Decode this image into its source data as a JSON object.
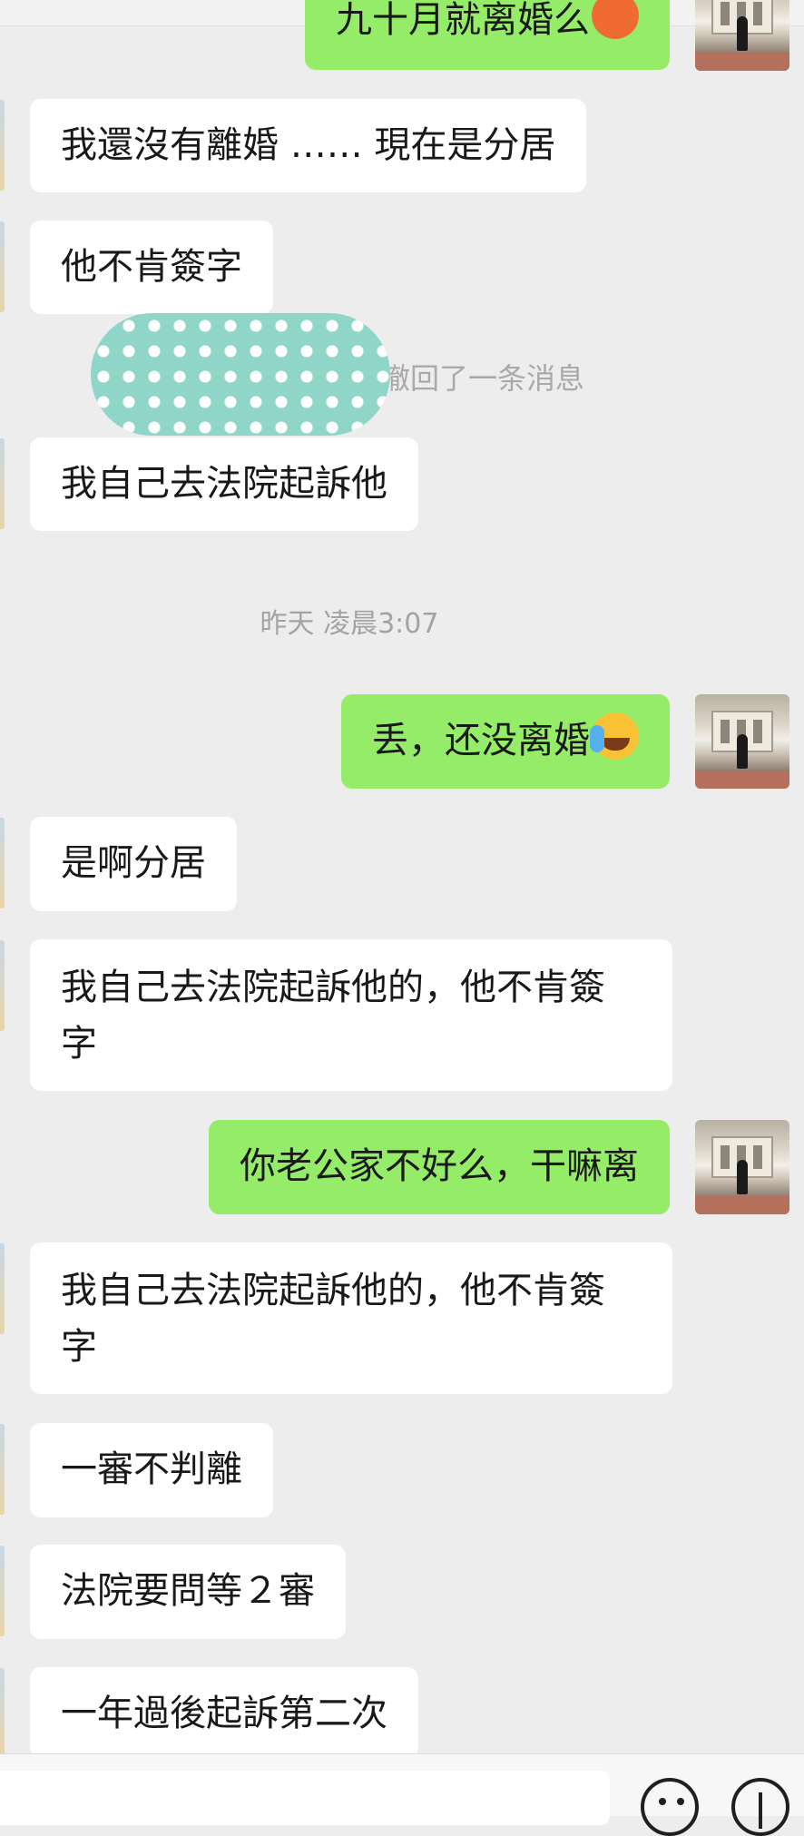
{
  "partial_top_message": {
    "text": "九十月就离婚么"
  },
  "system_notice": {
    "text": "撤回了一条消息"
  },
  "timestamp": {
    "text": "昨天 凌晨3:07"
  },
  "messages": [
    {
      "text": "我還沒有離婚 …… 現在是分居"
    },
    {
      "text": "他不肯簽字"
    },
    {
      "text": "我自己去法院起訴他"
    },
    {
      "text": "丢，还没离婚"
    },
    {
      "text": "是啊分居"
    },
    {
      "line1": "我自己去法院起訴他的，他不肯簽",
      "line2": "字"
    },
    {
      "text": "你老公家不好么，干嘛离"
    },
    {
      "line1": "我自己去法院起訴他的，他不肯簽",
      "line2": "字"
    },
    {
      "text": "一審不判離"
    },
    {
      "text": "法院要問等２審"
    },
    {
      "text": "一年過後起訴第二次"
    }
  ],
  "colors": {
    "background": "#ededed",
    "incoming_bubble": "#ffffff",
    "outgoing_bubble": "#95ec69"
  },
  "icons": [
    "angry-face-emoji",
    "crying-laughing-emoji",
    "emoji-icon",
    "plus-icon"
  ]
}
